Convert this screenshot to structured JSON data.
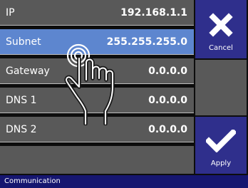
{
  "rows": [
    {
      "label": "IP",
      "value": "192.168.1.1"
    },
    {
      "label": "Subnet",
      "value": "255.255.255.0"
    },
    {
      "label": "Gateway",
      "value": "0.0.0.0"
    },
    {
      "label": "DNS 1",
      "value": "0.0.0.0"
    },
    {
      "label": "DNS 2",
      "value": "0.0.0.0"
    },
    {
      "label": "",
      "value": ""
    }
  ],
  "buttons": {
    "cancel": {
      "label": "Cancel",
      "icon": "close-icon"
    },
    "apply": {
      "label": "Apply",
      "icon": "checkmark-icon"
    }
  },
  "status": {
    "text": "Communication"
  },
  "colors": {
    "row": "#595959",
    "selected": "#5d86cf",
    "button": "#2f2f8c",
    "statusbar": "#161670"
  },
  "overlay": {
    "icon": "tap-hand-icon"
  }
}
